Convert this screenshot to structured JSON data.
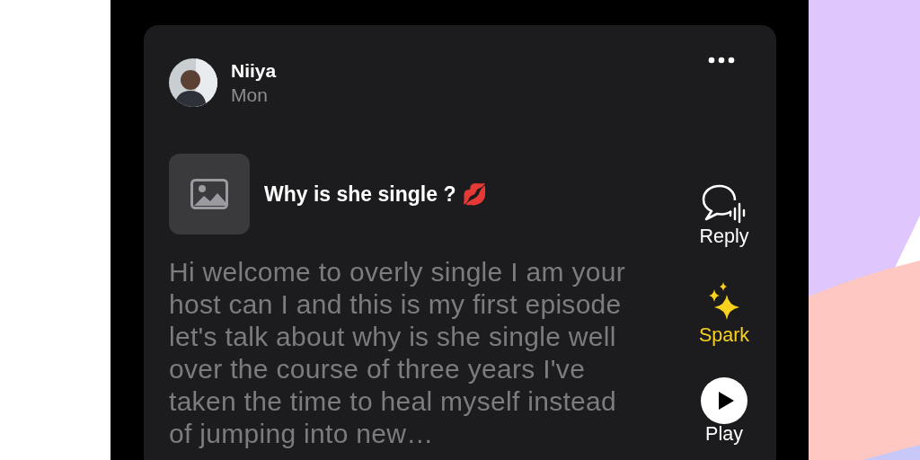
{
  "post": {
    "author": "Niiya",
    "time": "Mon",
    "title": "Why is she single ? 💋",
    "body": "Hi welcome to overly single I am your host can I and this is my first episode let's talk about why is she single well over the course of three years I've taken the time to heal myself instead of jumping into new…"
  },
  "actions": [
    {
      "kind": "reply",
      "label": "Reply",
      "highlighted": false
    },
    {
      "kind": "spark",
      "label": "Spark",
      "highlighted": true
    },
    {
      "kind": "play",
      "label": "Play",
      "highlighted": false
    }
  ]
}
